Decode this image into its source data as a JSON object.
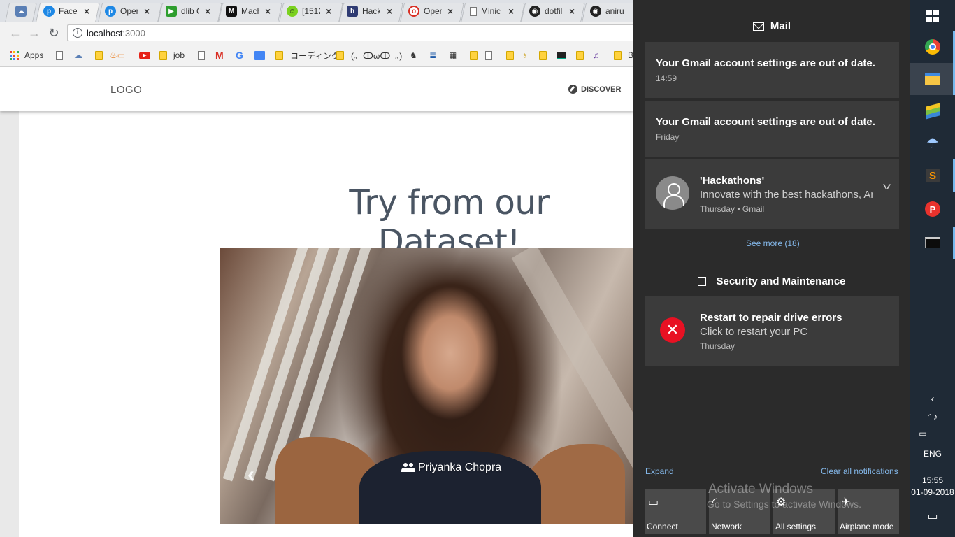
{
  "browser": {
    "tabs": [
      {
        "title": "",
        "favicon": "cloud-icon",
        "color": "#5a7fb5"
      },
      {
        "title": "Face",
        "favicon": "p-icon",
        "color": "#1e88e5"
      },
      {
        "title": "Oper",
        "favicon": "p-icon",
        "color": "#1e88e5"
      },
      {
        "title": "dlib C",
        "favicon": "dlib-icon",
        "color": "#2e9e2e"
      },
      {
        "title": "Mach",
        "favicon": "medium-icon",
        "color": "#111111"
      },
      {
        "title": "[1512",
        "favicon": "smiley-icon",
        "color": "#7bd11f"
      },
      {
        "title": "Hack",
        "favicon": "h-icon",
        "color": "#2f3b73"
      },
      {
        "title": "Oper",
        "favicon": "opencv-icon",
        "color": "#d93025"
      },
      {
        "title": "Minic",
        "favicon": "page-icon",
        "color": "#888888"
      },
      {
        "title": "dotfil",
        "favicon": "github-icon",
        "color": "#222222"
      },
      {
        "title": "aniru",
        "favicon": "github-icon",
        "color": "#222222"
      }
    ],
    "url": {
      "host": "localhost",
      "port": ":3000"
    },
    "bookmarks": {
      "apps": "Apps",
      "job": "job",
      "coding": "コーディング",
      "kaomoji": "(｡=ↀωↀ=｡)",
      "last": "B"
    }
  },
  "page": {
    "logo": "LOGO",
    "discover": "DISCOVER",
    "headline": "Try from our Dataset!",
    "caption": "Priyanka Chopra",
    "prev": "‹"
  },
  "action_center": {
    "mail_header": "Mail",
    "notifications": [
      {
        "title": "Your Gmail account settings are out of date.",
        "time": "14:59"
      },
      {
        "title": "Your Gmail account settings are out of date.",
        "time": "Friday"
      },
      {
        "title": "'Hackathons'",
        "body": "Innovate with the best hackathons, Ar",
        "meta": "Thursday • Gmail"
      }
    ],
    "see_more": "See more (18)",
    "security_header": "Security and Maintenance",
    "security_notification": {
      "title": "Restart to repair drive errors",
      "body": "Click to restart your PC",
      "time": "Thursday"
    },
    "expand": "Expand",
    "clear_all": "Clear all notifications",
    "watermark": {
      "line1": "Activate Windows",
      "line2": "Go to Settings to activate Windows."
    },
    "quick_actions": [
      {
        "label": "Connect",
        "icon": "connect-icon"
      },
      {
        "label": "Network",
        "icon": "network-icon"
      },
      {
        "label": "All settings",
        "icon": "gear-icon"
      },
      {
        "label": "Airplane mode",
        "icon": "airplane-icon"
      }
    ]
  },
  "taskbar": {
    "lang": "ENG",
    "time": "15:55",
    "date": "01-09-2018"
  },
  "colors": {
    "action_center_bg": "#2b2b2b",
    "notification_bg": "#3b3b3b",
    "link": "#84b8ea",
    "taskbar_bg": "#1f2a36",
    "error": "#e81123"
  }
}
